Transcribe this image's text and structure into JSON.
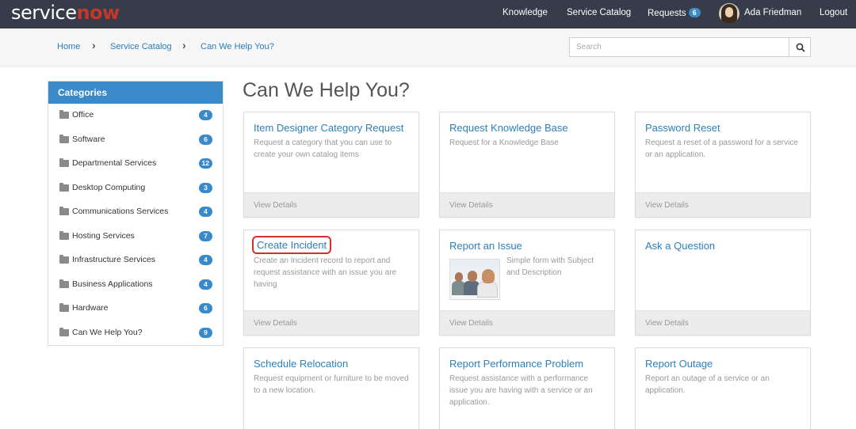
{
  "header": {
    "logo_part1": "service",
    "logo_part2": "now",
    "nav": {
      "knowledge": "Knowledge",
      "service_catalog": "Service Catalog",
      "requests": "Requests",
      "requests_count": "6",
      "user_name": "Ada Friedman",
      "logout": "Logout"
    }
  },
  "breadcrumb": [
    "Home",
    "Service Catalog",
    "Can We Help You?"
  ],
  "search": {
    "placeholder": "Search"
  },
  "sidebar": {
    "title": "Categories",
    "items": [
      {
        "label": "Office",
        "count": "4"
      },
      {
        "label": "Software",
        "count": "6"
      },
      {
        "label": "Departmental Services",
        "count": "12"
      },
      {
        "label": "Desktop Computing",
        "count": "3"
      },
      {
        "label": "Communications Services",
        "count": "4"
      },
      {
        "label": "Hosting Services",
        "count": "7"
      },
      {
        "label": "Infrastructure Services",
        "count": "4"
      },
      {
        "label": "Business Applications",
        "count": "4"
      },
      {
        "label": "Hardware",
        "count": "6"
      },
      {
        "label": "Can We Help You?",
        "count": "9"
      }
    ]
  },
  "main": {
    "title": "Can We Help You?",
    "footer_label": "View Details",
    "cards": [
      {
        "title": "Item Designer Category Request",
        "desc": "Request a category that you can use to create your own catalog items"
      },
      {
        "title": "Request Knowledge Base",
        "desc": "Request for a Knowledge Base"
      },
      {
        "title": "Password Reset",
        "desc": "Request a reset of a password for a service or an application."
      },
      {
        "title": "Create Incident",
        "desc": "Create an Incident record to report and request assistance with an issue you are having"
      },
      {
        "title": "Report an Issue",
        "desc": "Simple form with Subject and Description"
      },
      {
        "title": "Ask a Question",
        "desc": ""
      },
      {
        "title": "Schedule Relocation",
        "desc": "Request equipment or furniture to be moved to a new location."
      },
      {
        "title": "Report Performance Problem",
        "desc": "Request assistance with a performance issue you are having with a service or an application."
      },
      {
        "title": "Report Outage",
        "desc": "Report an outage of a service or an application."
      }
    ]
  },
  "colors": {
    "topbar": "#363c4a",
    "accent": "#3a89c9",
    "link": "#2d7fb8",
    "highlight": "#d0312d"
  }
}
